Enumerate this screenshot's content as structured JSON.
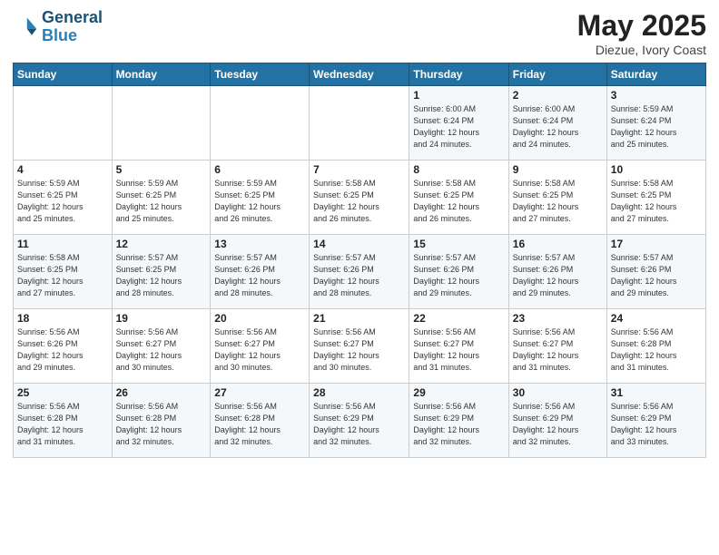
{
  "header": {
    "logo_line1": "General",
    "logo_line2": "Blue",
    "main_title": "May 2025",
    "subtitle": "Diezue, Ivory Coast"
  },
  "days_of_week": [
    "Sunday",
    "Monday",
    "Tuesday",
    "Wednesday",
    "Thursday",
    "Friday",
    "Saturday"
  ],
  "weeks": [
    [
      {
        "day": "",
        "info": ""
      },
      {
        "day": "",
        "info": ""
      },
      {
        "day": "",
        "info": ""
      },
      {
        "day": "",
        "info": ""
      },
      {
        "day": "1",
        "info": "Sunrise: 6:00 AM\nSunset: 6:24 PM\nDaylight: 12 hours\nand 24 minutes."
      },
      {
        "day": "2",
        "info": "Sunrise: 6:00 AM\nSunset: 6:24 PM\nDaylight: 12 hours\nand 24 minutes."
      },
      {
        "day": "3",
        "info": "Sunrise: 5:59 AM\nSunset: 6:24 PM\nDaylight: 12 hours\nand 25 minutes."
      }
    ],
    [
      {
        "day": "4",
        "info": "Sunrise: 5:59 AM\nSunset: 6:25 PM\nDaylight: 12 hours\nand 25 minutes."
      },
      {
        "day": "5",
        "info": "Sunrise: 5:59 AM\nSunset: 6:25 PM\nDaylight: 12 hours\nand 25 minutes."
      },
      {
        "day": "6",
        "info": "Sunrise: 5:59 AM\nSunset: 6:25 PM\nDaylight: 12 hours\nand 26 minutes."
      },
      {
        "day": "7",
        "info": "Sunrise: 5:58 AM\nSunset: 6:25 PM\nDaylight: 12 hours\nand 26 minutes."
      },
      {
        "day": "8",
        "info": "Sunrise: 5:58 AM\nSunset: 6:25 PM\nDaylight: 12 hours\nand 26 minutes."
      },
      {
        "day": "9",
        "info": "Sunrise: 5:58 AM\nSunset: 6:25 PM\nDaylight: 12 hours\nand 27 minutes."
      },
      {
        "day": "10",
        "info": "Sunrise: 5:58 AM\nSunset: 6:25 PM\nDaylight: 12 hours\nand 27 minutes."
      }
    ],
    [
      {
        "day": "11",
        "info": "Sunrise: 5:58 AM\nSunset: 6:25 PM\nDaylight: 12 hours\nand 27 minutes."
      },
      {
        "day": "12",
        "info": "Sunrise: 5:57 AM\nSunset: 6:25 PM\nDaylight: 12 hours\nand 28 minutes."
      },
      {
        "day": "13",
        "info": "Sunrise: 5:57 AM\nSunset: 6:26 PM\nDaylight: 12 hours\nand 28 minutes."
      },
      {
        "day": "14",
        "info": "Sunrise: 5:57 AM\nSunset: 6:26 PM\nDaylight: 12 hours\nand 28 minutes."
      },
      {
        "day": "15",
        "info": "Sunrise: 5:57 AM\nSunset: 6:26 PM\nDaylight: 12 hours\nand 29 minutes."
      },
      {
        "day": "16",
        "info": "Sunrise: 5:57 AM\nSunset: 6:26 PM\nDaylight: 12 hours\nand 29 minutes."
      },
      {
        "day": "17",
        "info": "Sunrise: 5:57 AM\nSunset: 6:26 PM\nDaylight: 12 hours\nand 29 minutes."
      }
    ],
    [
      {
        "day": "18",
        "info": "Sunrise: 5:56 AM\nSunset: 6:26 PM\nDaylight: 12 hours\nand 29 minutes."
      },
      {
        "day": "19",
        "info": "Sunrise: 5:56 AM\nSunset: 6:27 PM\nDaylight: 12 hours\nand 30 minutes."
      },
      {
        "day": "20",
        "info": "Sunrise: 5:56 AM\nSunset: 6:27 PM\nDaylight: 12 hours\nand 30 minutes."
      },
      {
        "day": "21",
        "info": "Sunrise: 5:56 AM\nSunset: 6:27 PM\nDaylight: 12 hours\nand 30 minutes."
      },
      {
        "day": "22",
        "info": "Sunrise: 5:56 AM\nSunset: 6:27 PM\nDaylight: 12 hours\nand 31 minutes."
      },
      {
        "day": "23",
        "info": "Sunrise: 5:56 AM\nSunset: 6:27 PM\nDaylight: 12 hours\nand 31 minutes."
      },
      {
        "day": "24",
        "info": "Sunrise: 5:56 AM\nSunset: 6:28 PM\nDaylight: 12 hours\nand 31 minutes."
      }
    ],
    [
      {
        "day": "25",
        "info": "Sunrise: 5:56 AM\nSunset: 6:28 PM\nDaylight: 12 hours\nand 31 minutes."
      },
      {
        "day": "26",
        "info": "Sunrise: 5:56 AM\nSunset: 6:28 PM\nDaylight: 12 hours\nand 32 minutes."
      },
      {
        "day": "27",
        "info": "Sunrise: 5:56 AM\nSunset: 6:28 PM\nDaylight: 12 hours\nand 32 minutes."
      },
      {
        "day": "28",
        "info": "Sunrise: 5:56 AM\nSunset: 6:29 PM\nDaylight: 12 hours\nand 32 minutes."
      },
      {
        "day": "29",
        "info": "Sunrise: 5:56 AM\nSunset: 6:29 PM\nDaylight: 12 hours\nand 32 minutes."
      },
      {
        "day": "30",
        "info": "Sunrise: 5:56 AM\nSunset: 6:29 PM\nDaylight: 12 hours\nand 32 minutes."
      },
      {
        "day": "31",
        "info": "Sunrise: 5:56 AM\nSunset: 6:29 PM\nDaylight: 12 hours\nand 33 minutes."
      }
    ]
  ]
}
